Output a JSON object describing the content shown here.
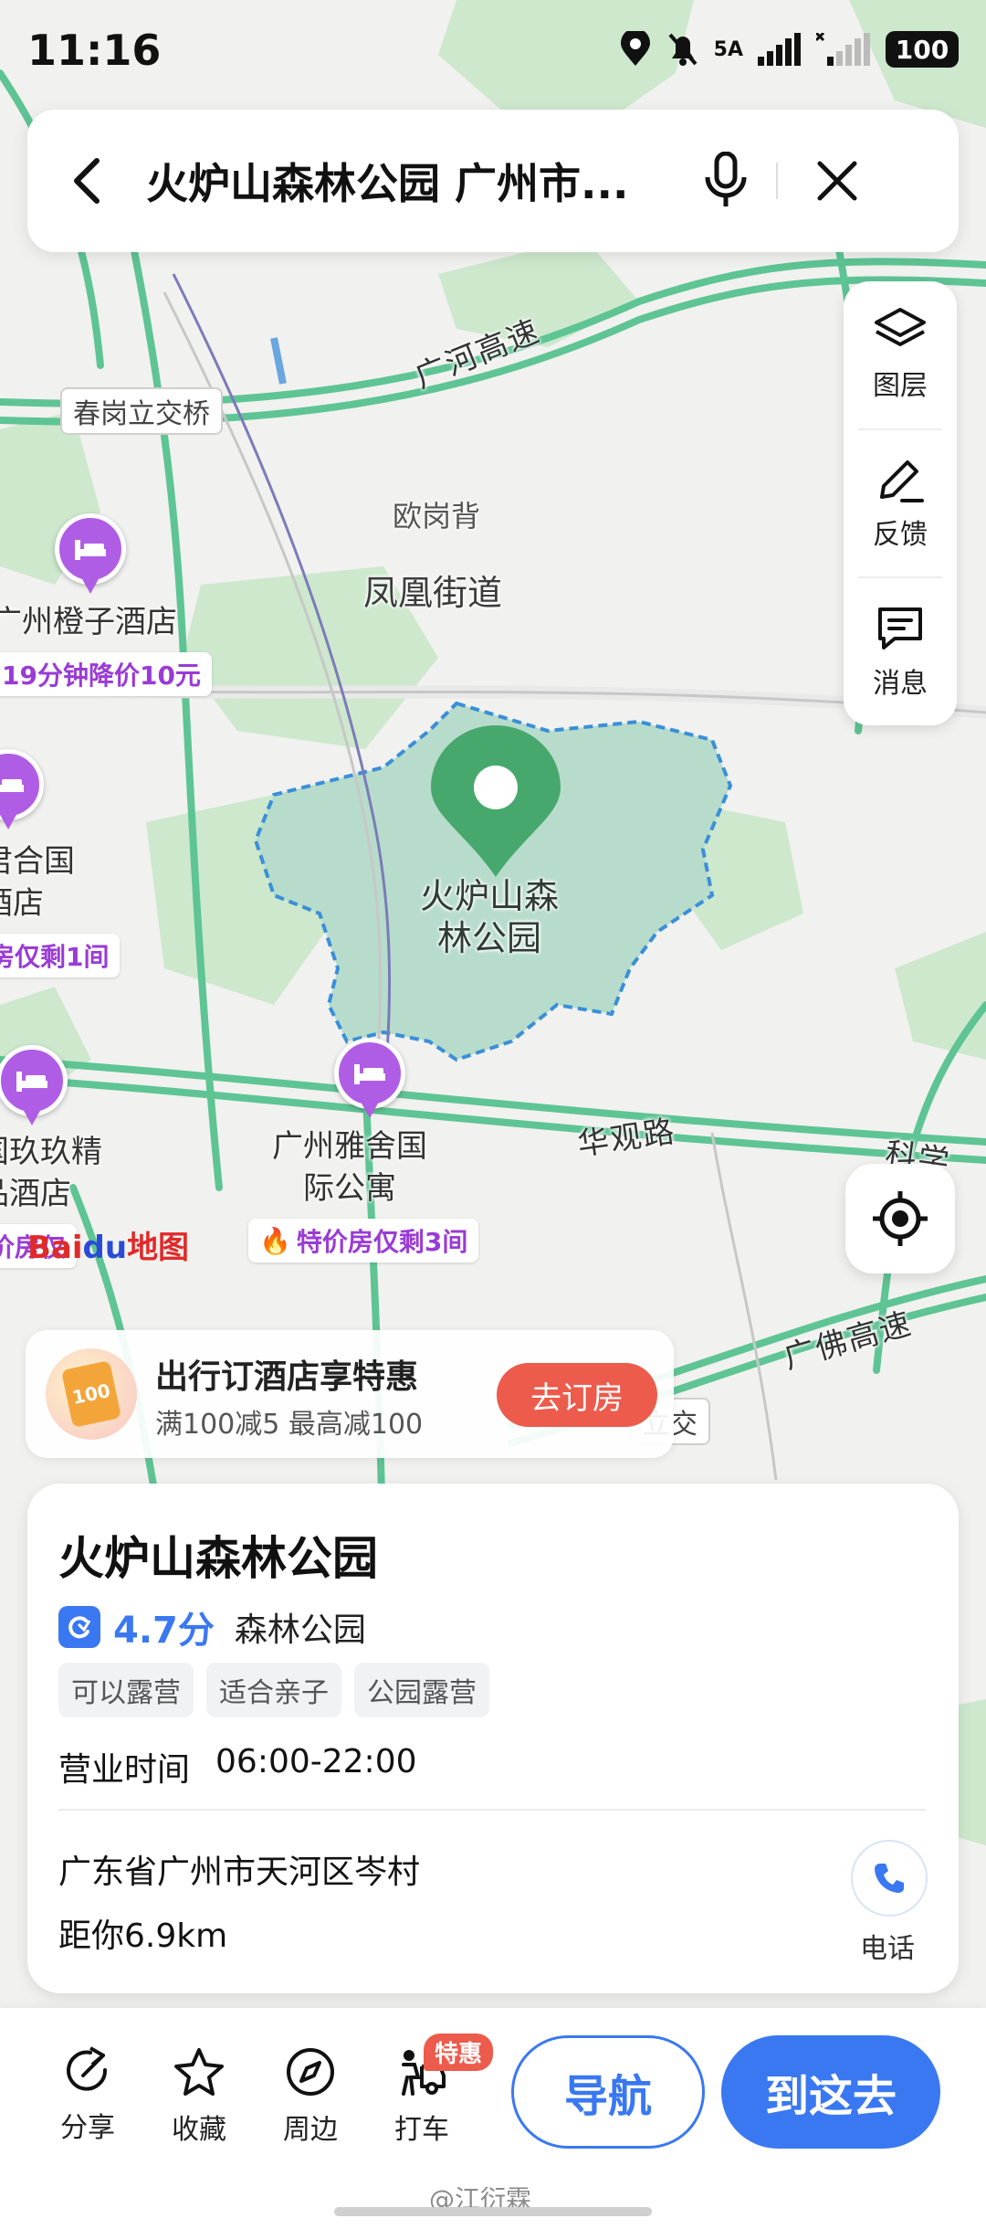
{
  "status_bar": {
    "time": "11:16",
    "network": "5A",
    "battery": "100"
  },
  "search": {
    "query": "火炉山森林公园 广州市..."
  },
  "right_tools": [
    {
      "icon": "layers-icon",
      "label": "图层"
    },
    {
      "icon": "feedback-pen-icon",
      "label": "反馈"
    },
    {
      "icon": "message-icon",
      "label": "消息"
    }
  ],
  "map": {
    "roads": [
      "广河高速",
      "华观路",
      "科学",
      "广佛高速"
    ],
    "bridges": [
      "春岗立交桥",
      "立交"
    ],
    "areas": [
      "欧岗背",
      "凤凰街道"
    ],
    "park_label": "火炉山森\n林公园",
    "hotels": [
      {
        "name": "广州橙子酒店",
        "promo": "19分钟降价10元"
      },
      {
        "name": "君合国\n酒店",
        "promo": "房仅剩1间"
      },
      {
        "name": "国玖玖精\n品酒店",
        "promo": "价房仅"
      },
      {
        "name": "广州雅舍国\n际公寓",
        "promo": "特价房仅剩3间"
      }
    ],
    "logo": {
      "part1": "Bai",
      "part2": "du",
      "part3": "地图"
    }
  },
  "hotel_promo": {
    "badge": "100",
    "title": "出行订酒店享特惠",
    "subtitle": "满100减5 最高减100",
    "button": "去订房"
  },
  "place": {
    "name": "火炉山森林公园",
    "rating": "4.7分",
    "category": "森林公园",
    "tags": [
      "可以露营",
      "适合亲子",
      "公园露营"
    ],
    "hours_label": "营业时间",
    "hours": "06:00-22:00",
    "address": "广东省广州市天河区岑村",
    "distance": "距你6.9km",
    "phone_label": "电话"
  },
  "bottom_bar": {
    "actions": [
      {
        "icon": "share-icon",
        "label": "分享"
      },
      {
        "icon": "star-icon",
        "label": "收藏"
      },
      {
        "icon": "compass-icon",
        "label": "周边"
      },
      {
        "icon": "taxi-icon",
        "label": "打车"
      }
    ],
    "taxi_badge": "特惠",
    "nav_button": "导航",
    "go_button": "到这去"
  },
  "watermark": "@江衍霖",
  "colors": {
    "accent": "#3a78f2",
    "road": "#5ec494",
    "park": "#b7dccb",
    "hotel": "#b05de6",
    "promo_button": "#ec5b4b"
  }
}
